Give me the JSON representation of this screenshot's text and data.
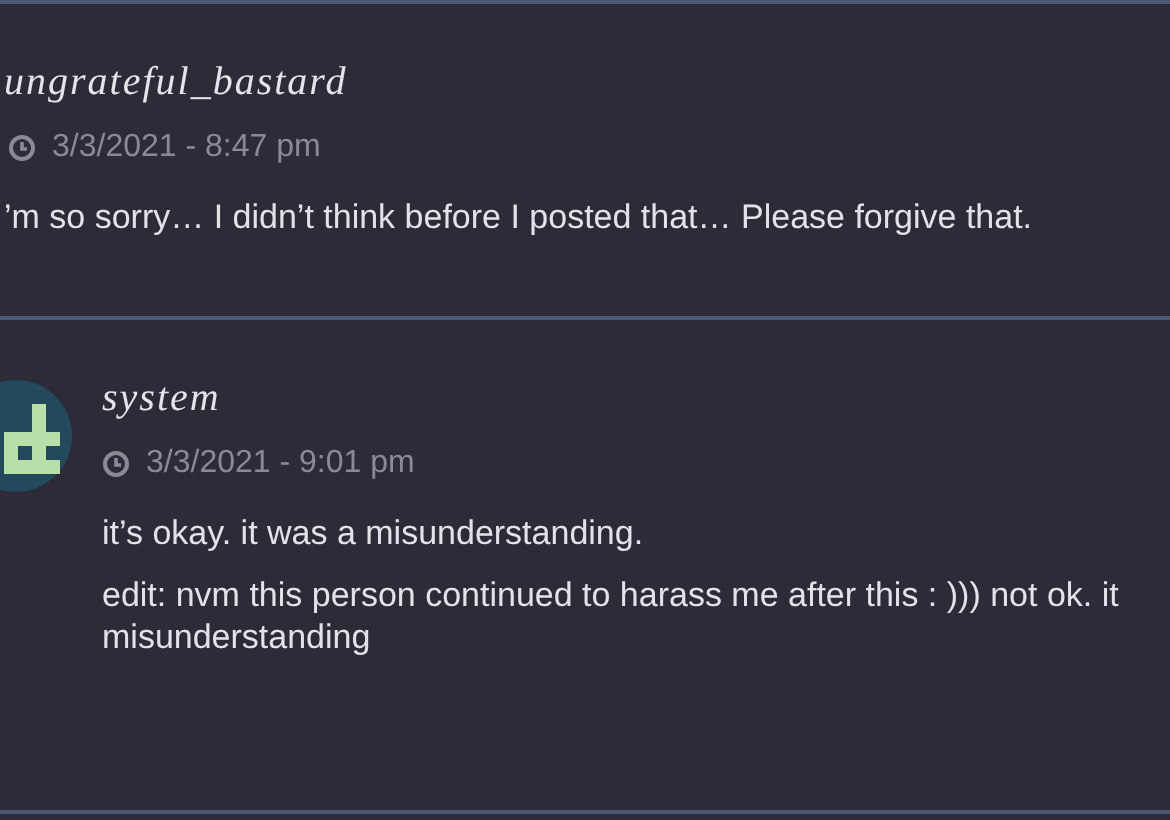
{
  "posts": [
    {
      "author": "ungrateful_bastard",
      "time": "3/3/2021 - 8:47 pm",
      "has_avatar": false,
      "paragraphs": [
        [
          "’m so sorry… I didn’t think before I posted that… Please forgive that."
        ]
      ]
    },
    {
      "author": "system",
      "time": "3/3/2021 - 9:01 pm",
      "has_avatar": true,
      "paragraphs": [
        [
          "it’s okay. it was a misunderstanding."
        ],
        [
          "edit: nvm this person continued to harass me after this : ))) not ok. it",
          "misunderstanding"
        ]
      ]
    }
  ]
}
